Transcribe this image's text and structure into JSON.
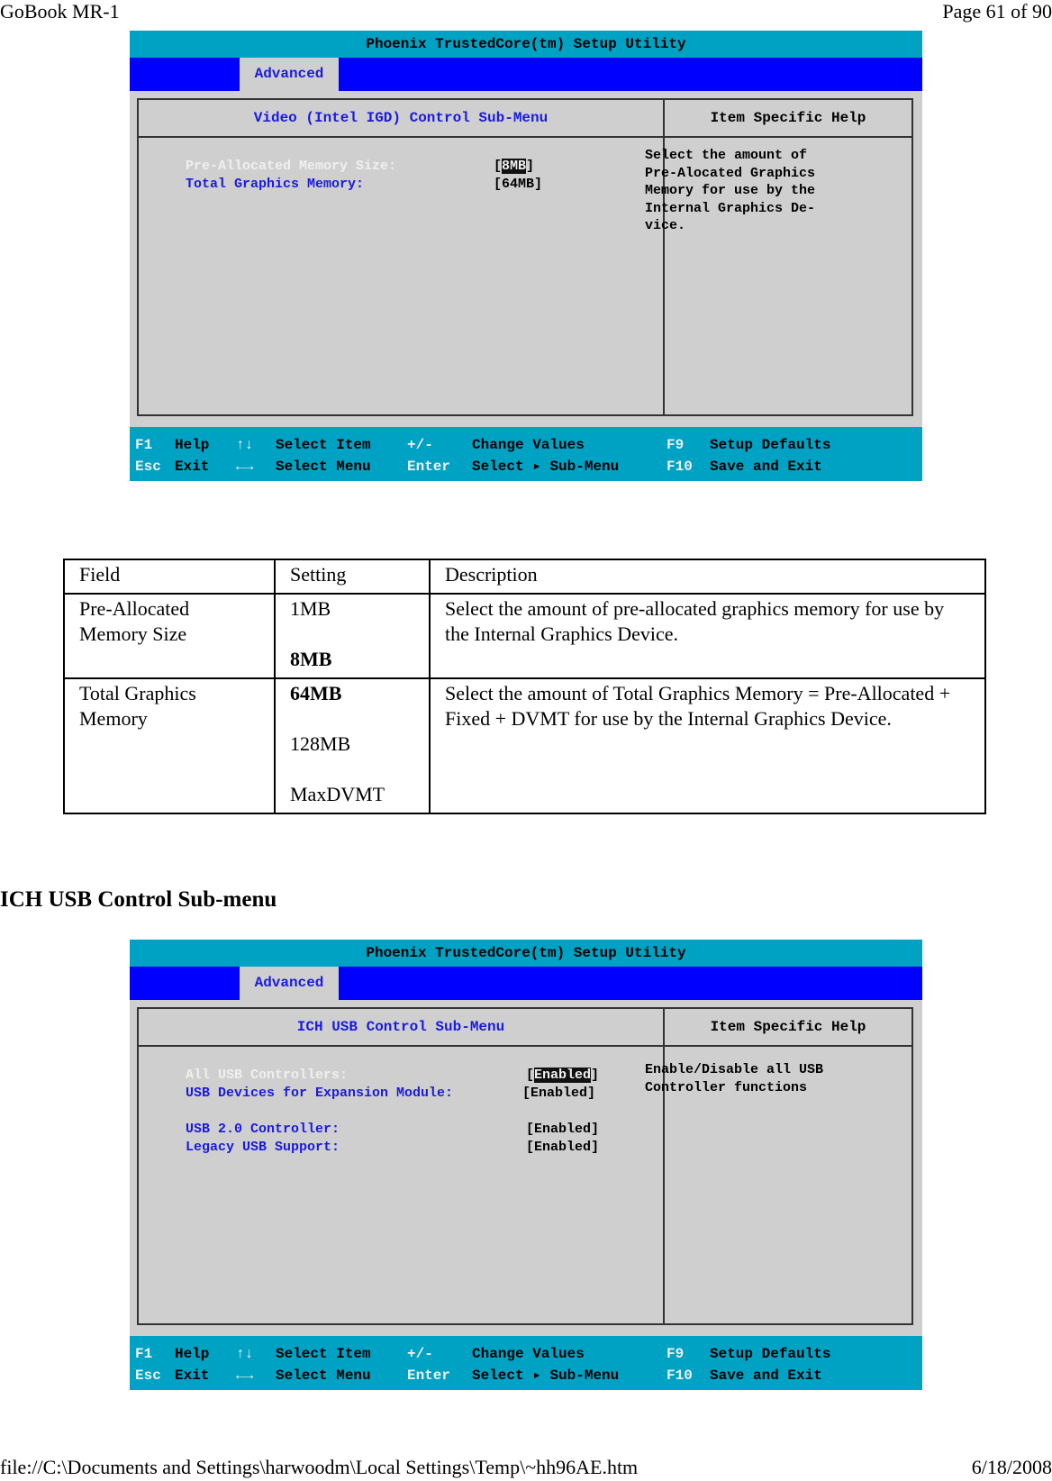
{
  "page_header": {
    "left": "GoBook MR-1",
    "right": "Page 61 of 90"
  },
  "page_footer": {
    "left": "file://C:\\Documents and Settings\\harwoodm\\Local Settings\\Temp\\~hh96AE.htm",
    "right": "6/18/2008"
  },
  "bios_screens": [
    {
      "title": "Phoenix TrustedCore(tm) Setup Utility",
      "active_tab": "Advanced",
      "submenu_title": "Video (Intel IGD) Control Sub-Menu",
      "help_title": "Item Specific Help",
      "help_text": "Select the amount of\nPre-Alocated Graphics\nMemory for use by the\nInternal Graphics De-\nvice.",
      "items": [
        {
          "label": "Pre-Allocated Memory Size:",
          "value": "8MB",
          "selected": true
        },
        {
          "label": "Total Graphics Memory:",
          "value": "64MB",
          "selected": false
        }
      ]
    },
    {
      "title": "Phoenix TrustedCore(tm) Setup Utility",
      "active_tab": "Advanced",
      "submenu_title": "ICH USB Control Sub-Menu",
      "help_title": "Item Specific Help",
      "help_text": "Enable/Disable all USB\nController functions",
      "items": [
        {
          "label": "All USB Controllers:",
          "value": "Enabled",
          "selected": true
        },
        {
          "label": "USB Devices for Expansion Module:",
          "value": "Enabled",
          "selected": false
        },
        {
          "label": "USB 2.0 Controller:",
          "value": "Enabled",
          "selected": false
        },
        {
          "label": "Legacy USB Support:",
          "value": "Enabled",
          "selected": false
        }
      ]
    }
  ],
  "key_legend": {
    "row1": [
      {
        "key": "F1",
        "desc": "Help"
      },
      {
        "key": "↑↓",
        "desc": "Select Item"
      },
      {
        "key": "+/-",
        "desc": "Change Values"
      },
      {
        "key": "F9",
        "desc": "Setup Defaults"
      }
    ],
    "row2": [
      {
        "key": "Esc",
        "desc": "Exit"
      },
      {
        "key": "←→",
        "desc": "Select Menu"
      },
      {
        "key": "Enter",
        "desc": "Select ▸ Sub-Menu"
      },
      {
        "key": "F10",
        "desc": "Save and Exit"
      }
    ]
  },
  "settings_table": {
    "headers": [
      "Field",
      "Setting",
      "Description"
    ],
    "rows": [
      {
        "field": "Pre-Allocated Memory Size",
        "settings": [
          {
            "value": "1MB",
            "default": false
          },
          {
            "value": "8MB",
            "default": true
          }
        ],
        "description": "Select the amount of pre-allocated graphics memory for use by the Internal Graphics Device."
      },
      {
        "field": "Total Graphics Memory",
        "settings": [
          {
            "value": "64MB",
            "default": true
          },
          {
            "value": "128MB",
            "default": false
          },
          {
            "value": "MaxDVMT",
            "default": false
          }
        ],
        "description": "Select the amount of Total Graphics Memory = Pre-Allocated + Fixed + DVMT for use by the Internal Graphics Device."
      }
    ]
  },
  "section_heading": "ICH USB Control Sub-menu"
}
